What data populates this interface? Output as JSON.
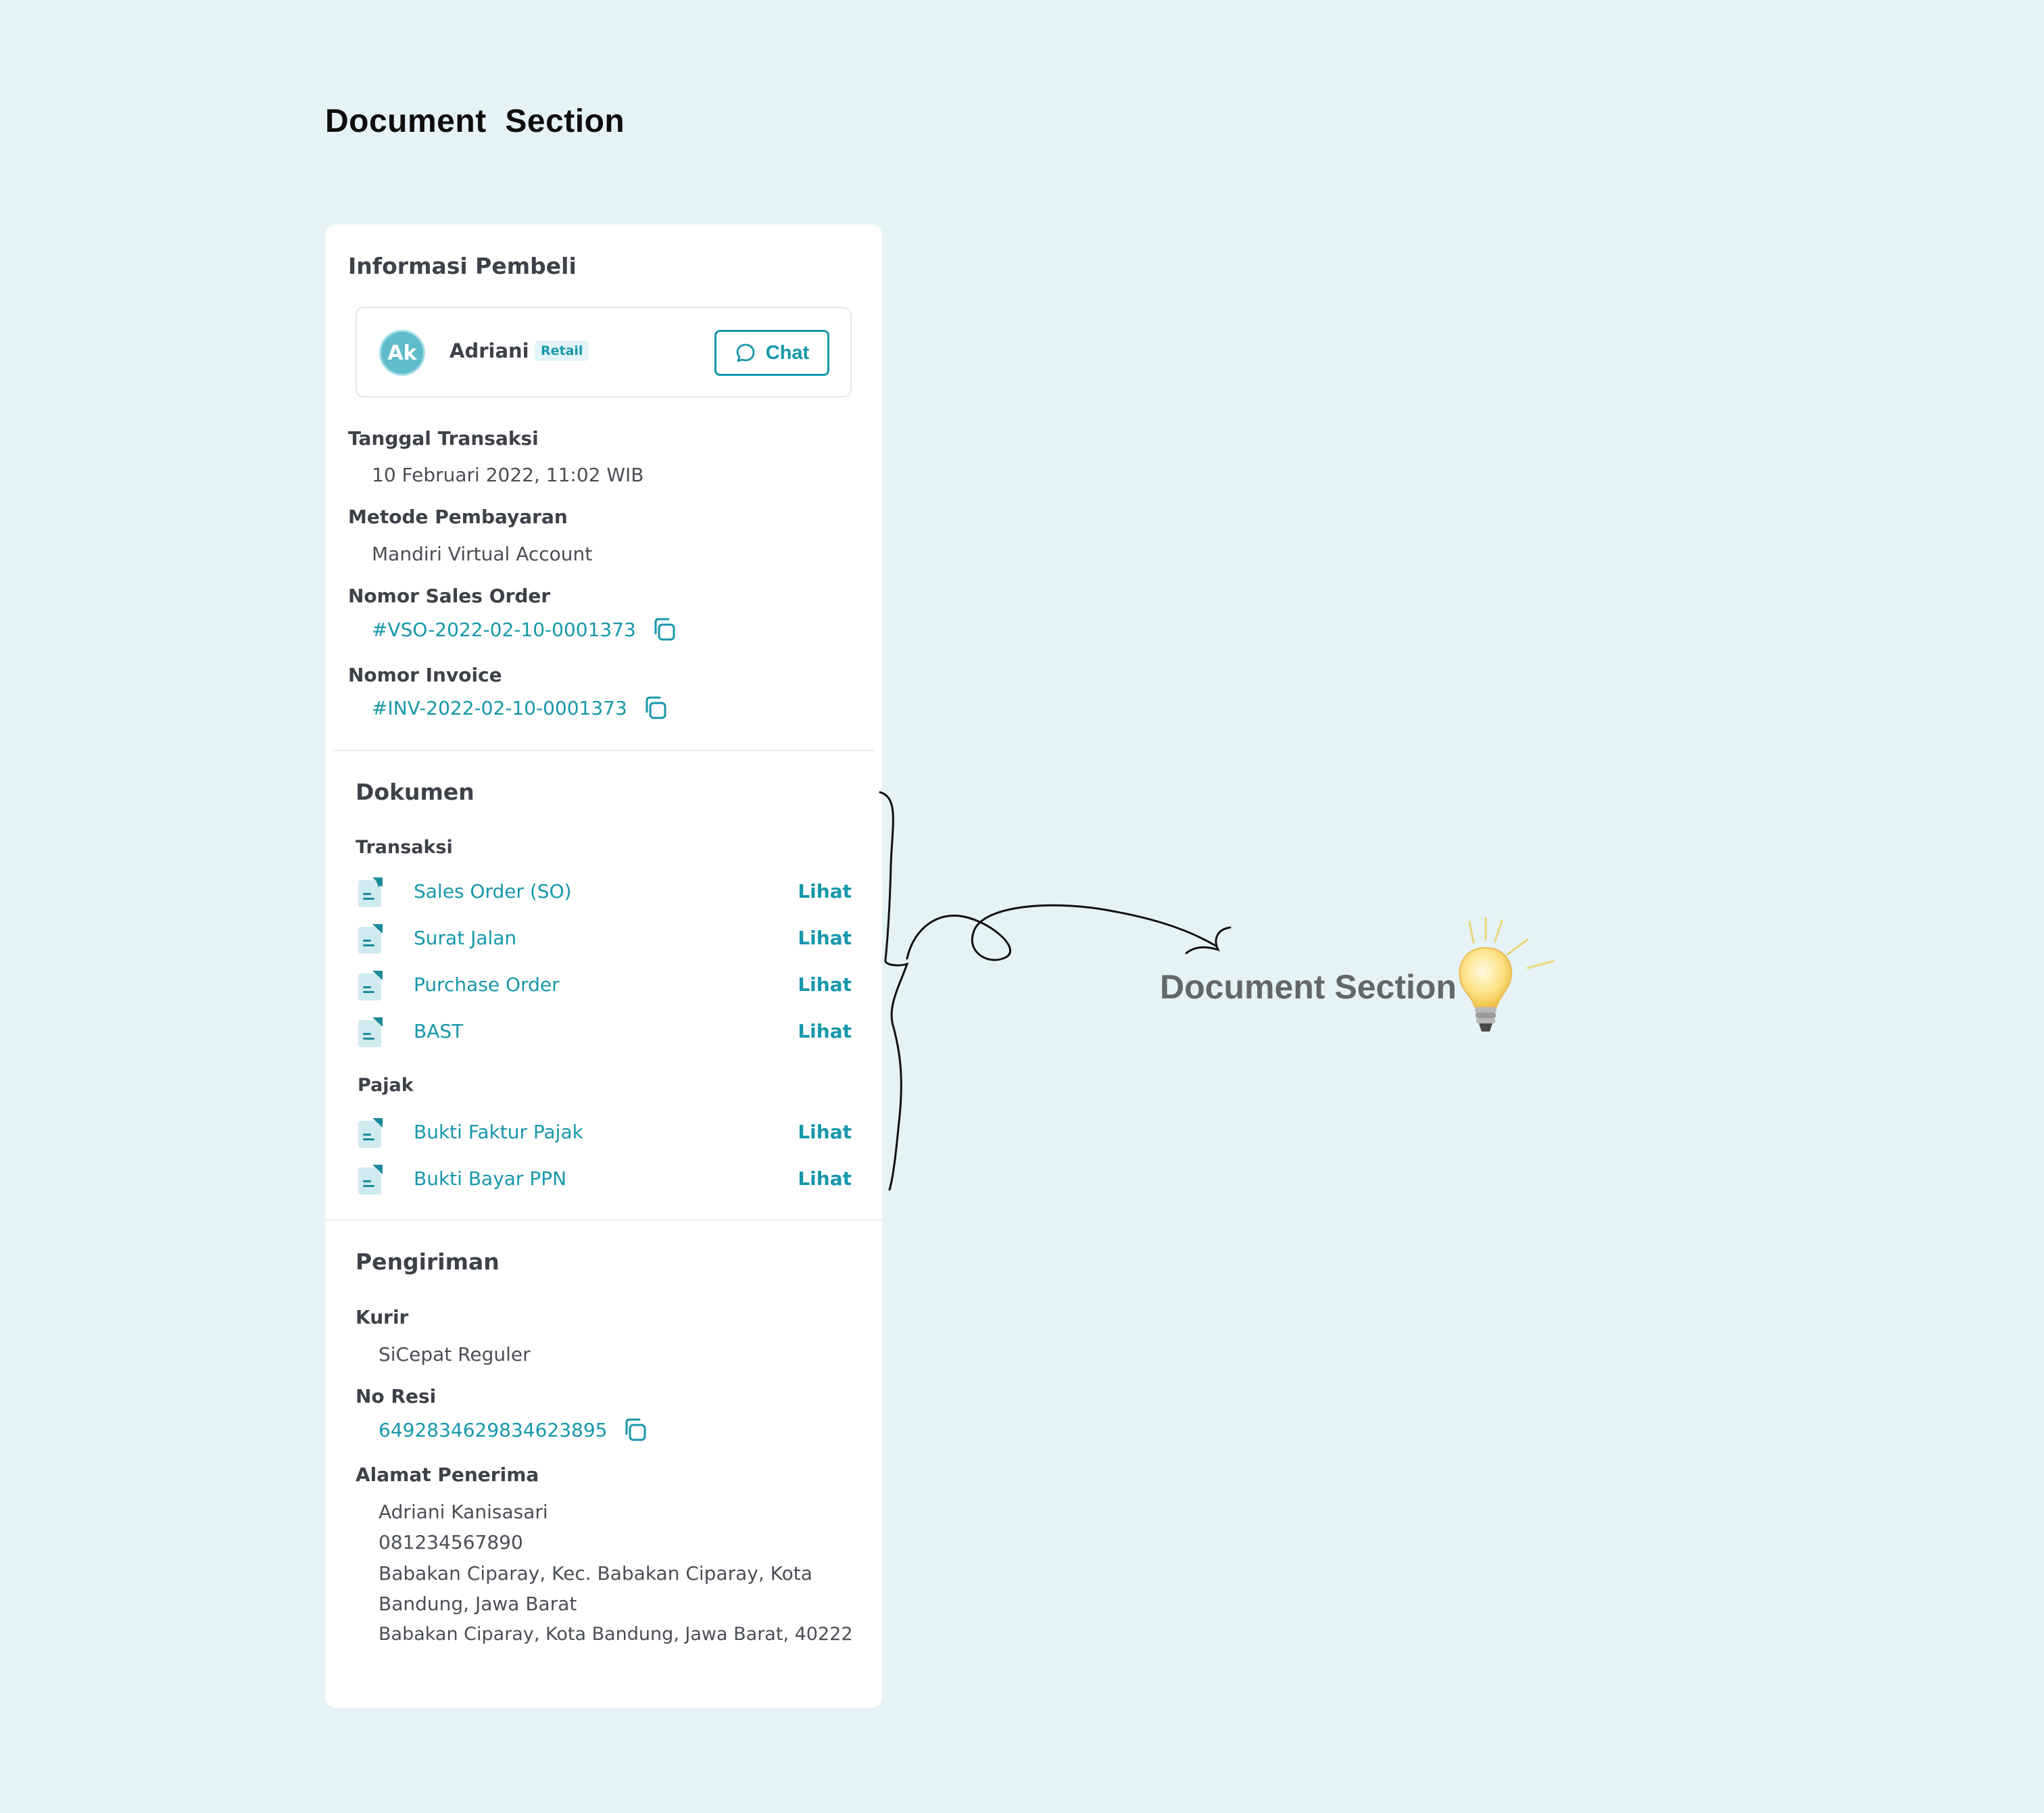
{
  "page_heading": "Document  Section",
  "buyer_info": {
    "title": "Informasi Pembeli",
    "avatar_initials": "Ak",
    "name": "Adriani",
    "badge": "Retail",
    "chat_label": "Chat"
  },
  "transaction": {
    "date_label": "Tanggal Transaksi",
    "date_value": "10 Februari 2022, 11:02 WIB",
    "payment_label": "Metode Pembayaran",
    "payment_value": "Mandiri Virtual Account",
    "so_label": "Nomor Sales Order",
    "so_value": "#VSO-2022-02-10-0001373",
    "invoice_label": "Nomor Invoice",
    "invoice_value": "#INV-2022-02-10-0001373"
  },
  "documents": {
    "title": "Dokumen",
    "transaction_group": "Transaksi",
    "transaction_docs": [
      {
        "name": "Sales Order (SO)",
        "action": "Lihat"
      },
      {
        "name": "Surat Jalan",
        "action": "Lihat"
      },
      {
        "name": "Purchase Order",
        "action": "Lihat"
      },
      {
        "name": "BAST",
        "action": "Lihat"
      }
    ],
    "tax_group": "Pajak",
    "tax_docs": [
      {
        "name": "Bukti Faktur Pajak",
        "action": "Lihat"
      },
      {
        "name": "Bukti Bayar PPN",
        "action": "Lihat"
      }
    ]
  },
  "shipping": {
    "title": "Pengiriman",
    "courier_label": "Kurir",
    "courier_value": "SiCepat Reguler",
    "receipt_label": "No Resi",
    "receipt_value": "6492834629834623895",
    "address_label": "Alamat Penerima",
    "address_lines": [
      "Adriani Kanisasari",
      "081234567890",
      "Babakan Ciparay, Kec. Babakan Ciparay, Kota",
      "Bandung, Jawa Barat",
      "Babakan Ciparay, Kota Bandung, Jawa Barat, 40222"
    ]
  },
  "annotation": "Document Section",
  "colors": {
    "background": "#e5f3f7",
    "accent": "#1697ab",
    "card": "#ffffff",
    "text": "#3d4148"
  },
  "icons": [
    "chat-bubble-icon",
    "copy-icon",
    "document-icon",
    "lightbulb-icon"
  ]
}
